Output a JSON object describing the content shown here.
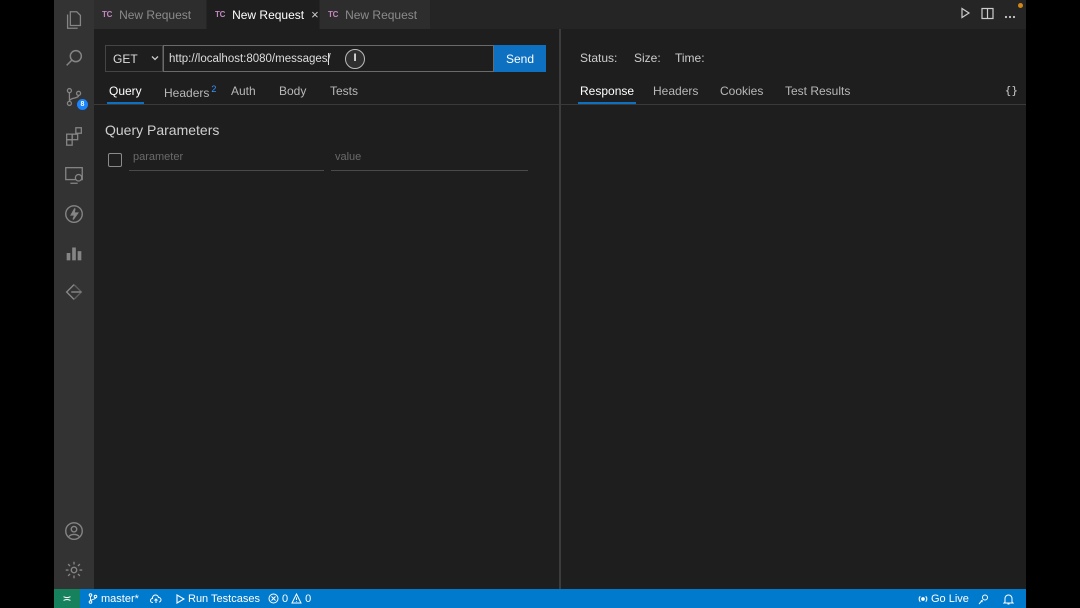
{
  "activity_bar": {
    "icons": [
      "files-icon",
      "search-icon",
      "source-control-icon",
      "extensions-icon",
      "remote-explorer-icon",
      "thunder-client-icon",
      "charts-icon",
      "live-share-icon",
      "account-icon",
      "settings-gear-icon"
    ],
    "source_control_badge": "8"
  },
  "tabs": [
    {
      "icon": "TC",
      "label": "New Request"
    },
    {
      "icon": "TC",
      "label": "New Request",
      "close": "×"
    },
    {
      "icon": "TC",
      "label": "New Request"
    }
  ],
  "request": {
    "method": "GET",
    "url": "http://localhost:8080/messages/",
    "send_label": "Send",
    "cursor_glyph": "I"
  },
  "request_tabs": [
    {
      "label": "Query"
    },
    {
      "label": "Headers",
      "count": "2"
    },
    {
      "label": "Auth"
    },
    {
      "label": "Body"
    },
    {
      "label": "Tests"
    }
  ],
  "query": {
    "title": "Query Parameters",
    "param_placeholder": "parameter",
    "value_placeholder": "value"
  },
  "response": {
    "status_label": "Status:",
    "size_label": "Size:",
    "time_label": "Time:",
    "tabs": [
      "Response",
      "Headers",
      "Cookies",
      "Test Results"
    ],
    "braces": "{}"
  },
  "statusbar": {
    "remote_glyph": "≍",
    "branch": "master*",
    "run_testcases": "Run Testcases",
    "errors": "0",
    "warnings": "0",
    "go_live": "Go Live"
  },
  "colors": {
    "accent": "#007acc",
    "send_button": "#0e70c0",
    "remote": "#16825d",
    "tc_icon": "#c586c0",
    "badge": "#1a85ff"
  }
}
